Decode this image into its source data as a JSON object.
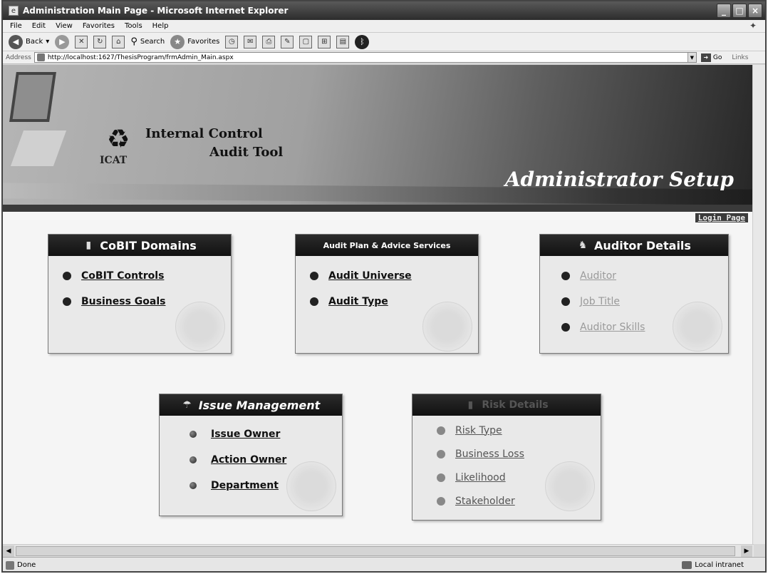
{
  "window": {
    "title": "Administration Main Page - Microsoft Internet Explorer"
  },
  "menubar": {
    "items": [
      "File",
      "Edit",
      "View",
      "Favorites",
      "Tools",
      "Help"
    ]
  },
  "toolbar": {
    "back": "Back",
    "search": "Search",
    "favorites": "Favorites"
  },
  "address": {
    "label": "Address",
    "url": "http://localhost:1627/ThesisProgram/frmAdmin_Main.aspx",
    "go": "Go",
    "links": "Links"
  },
  "banner": {
    "brand_line1": "Internal Control",
    "brand_line2": "Audit Tool",
    "brand_short": "ICAT",
    "title": "Administrator Setup",
    "login_link": "Login Page"
  },
  "panels": {
    "cobit": {
      "title": "CoBIT Domains",
      "items": [
        "CoBIT Controls",
        "Business Goals"
      ]
    },
    "audit_plan": {
      "title": "Audit Plan & Advice Services",
      "items": [
        "Audit Universe",
        "Audit Type"
      ]
    },
    "auditor": {
      "title": "Auditor Details",
      "items": [
        "Auditor",
        "Job Title",
        "Auditor Skills"
      ]
    },
    "issue": {
      "title": "Issue Management",
      "items": [
        "Issue Owner",
        "Action Owner",
        "Department"
      ]
    },
    "risk": {
      "title": "Risk Details",
      "items": [
        "Risk Type",
        "Business Loss",
        "Likelihood",
        "Stakeholder"
      ]
    }
  },
  "status": {
    "text": "Done",
    "zone": "Local intranet"
  }
}
